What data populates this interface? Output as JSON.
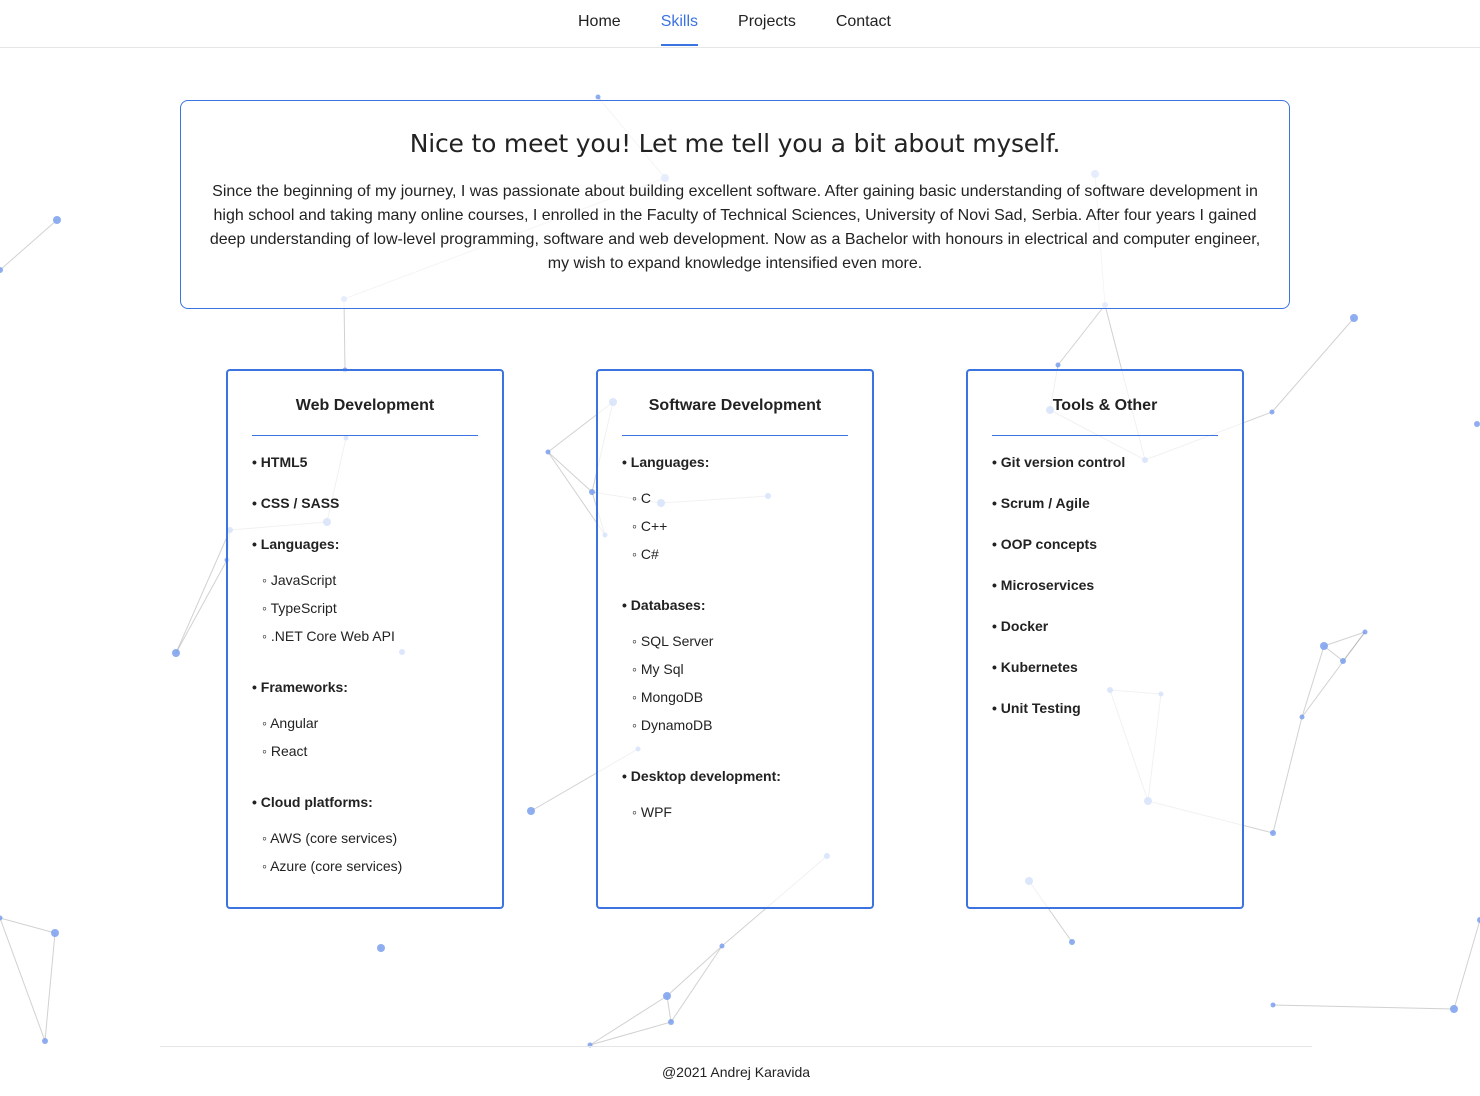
{
  "nav": {
    "items": [
      {
        "label": "Home",
        "active": false
      },
      {
        "label": "Skills",
        "active": true
      },
      {
        "label": "Projects",
        "active": false
      },
      {
        "label": "Contact",
        "active": false
      }
    ]
  },
  "intro": {
    "title": "Nice to meet you! Let me tell you a bit about myself.",
    "text": "Since the beginning of my journey, I was passionate about building excellent software. After gaining basic understanding of software development in high school and taking many online courses, I enrolled in the Faculty of Technical Sciences, University of Novi Sad, Serbia. After four years I gained deep understanding of low-level programming, software and web development. Now as a Bachelor with honours in electrical and computer engineer, my wish to expand knowledge intensified even more."
  },
  "cards": [
    {
      "title": "Web Development",
      "items": [
        {
          "label": "• HTML5",
          "sub": []
        },
        {
          "label": "• CSS / SASS",
          "sub": []
        },
        {
          "label": "• Languages:",
          "sub": [
            "◦ JavaScript",
            "◦ TypeScript",
            "◦ .NET Core Web API"
          ]
        },
        {
          "label": "• Frameworks:",
          "sub": [
            "◦ Angular",
            "◦ React"
          ]
        },
        {
          "label": "• Cloud platforms:",
          "sub": [
            "◦ AWS (core services)",
            "◦ Azure (core services)"
          ]
        }
      ]
    },
    {
      "title": "Software Development",
      "items": [
        {
          "label": "• Languages:",
          "sub": [
            "◦ C",
            "◦ C++",
            "◦ C#"
          ]
        },
        {
          "label": "• Databases:",
          "sub": [
            "◦ SQL Server",
            "◦ My Sql",
            "◦ MongoDB",
            "◦ DynamoDB"
          ]
        },
        {
          "label": "• Desktop development:",
          "sub": [
            "◦ WPF"
          ]
        }
      ]
    },
    {
      "title": "Tools & Other",
      "items": [
        {
          "label": "• Git version control",
          "sub": []
        },
        {
          "label": "• Scrum / Agile",
          "sub": []
        },
        {
          "label": "• OOP concepts",
          "sub": []
        },
        {
          "label": "• Microservices",
          "sub": []
        },
        {
          "label": "• Docker",
          "sub": []
        },
        {
          "label": "• Kubernetes",
          "sub": []
        },
        {
          "label": "• Unit Testing",
          "sub": []
        }
      ]
    }
  ],
  "footer": {
    "text": "@2021 Andrej Karavida"
  },
  "colors": {
    "accent": "#3b73e0",
    "particle": "#7aa0ee",
    "particle_line": "#999999"
  }
}
